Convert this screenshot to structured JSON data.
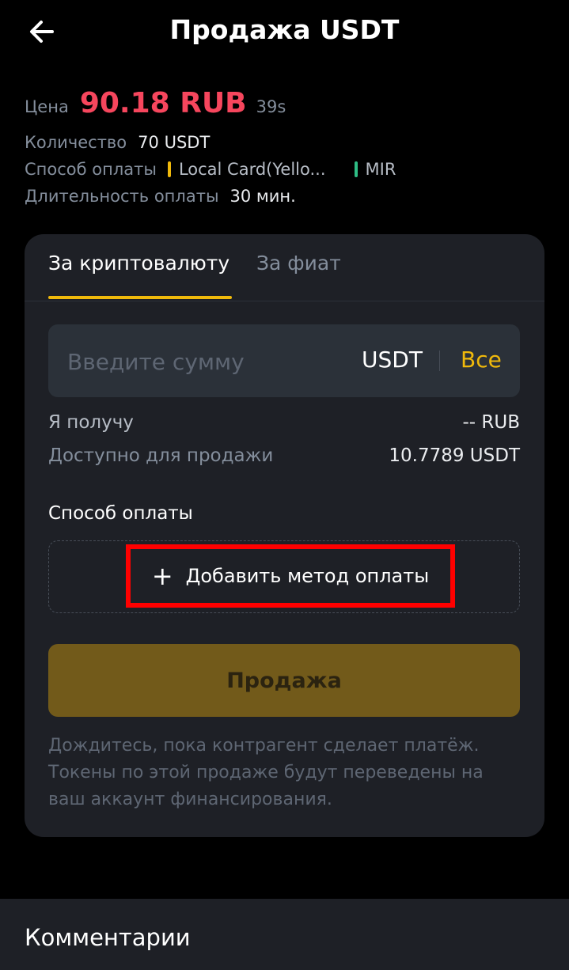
{
  "header": {
    "title": "Продажа USDT",
    "back_icon": "arrow-left-icon"
  },
  "info": {
    "price_label": "Цена",
    "price_value": "90.18 RUB",
    "timer": "39s",
    "quantity_label": "Количество",
    "quantity_value": "70 USDT",
    "payment_label": "Способ оплаты",
    "payment_methods": [
      {
        "name": "Local Card(Yello...",
        "color": "#f0b90b"
      },
      {
        "name": "MIR",
        "color": "#2ebd85"
      }
    ],
    "duration_label": "Длительность оплаты",
    "duration_value": "30 мин."
  },
  "card": {
    "tabs": [
      {
        "label": "За криптовалюту",
        "active": true
      },
      {
        "label": "За фиат",
        "active": false
      }
    ],
    "amount": {
      "placeholder": "Введите сумму",
      "value": "",
      "currency": "USDT",
      "all_label": "Все"
    },
    "receive_label": "Я получу",
    "receive_value": "-- RUB",
    "available_label": "Доступно для продажи",
    "available_value": "10.7789 USDT",
    "payment_section_title": "Способ оплаты",
    "add_method_label": "Добавить метод оплаты",
    "sell_label": "Продажа",
    "note": "Дождитесь, пока контрагент сделает платёж. Токены по этой продаже будут переведены на ваш аккаунт финансирования."
  },
  "comments": {
    "title": "Комментарии"
  },
  "colors": {
    "accent": "#f0b90b",
    "price": "#f6465d",
    "highlight": "#ff0000"
  }
}
